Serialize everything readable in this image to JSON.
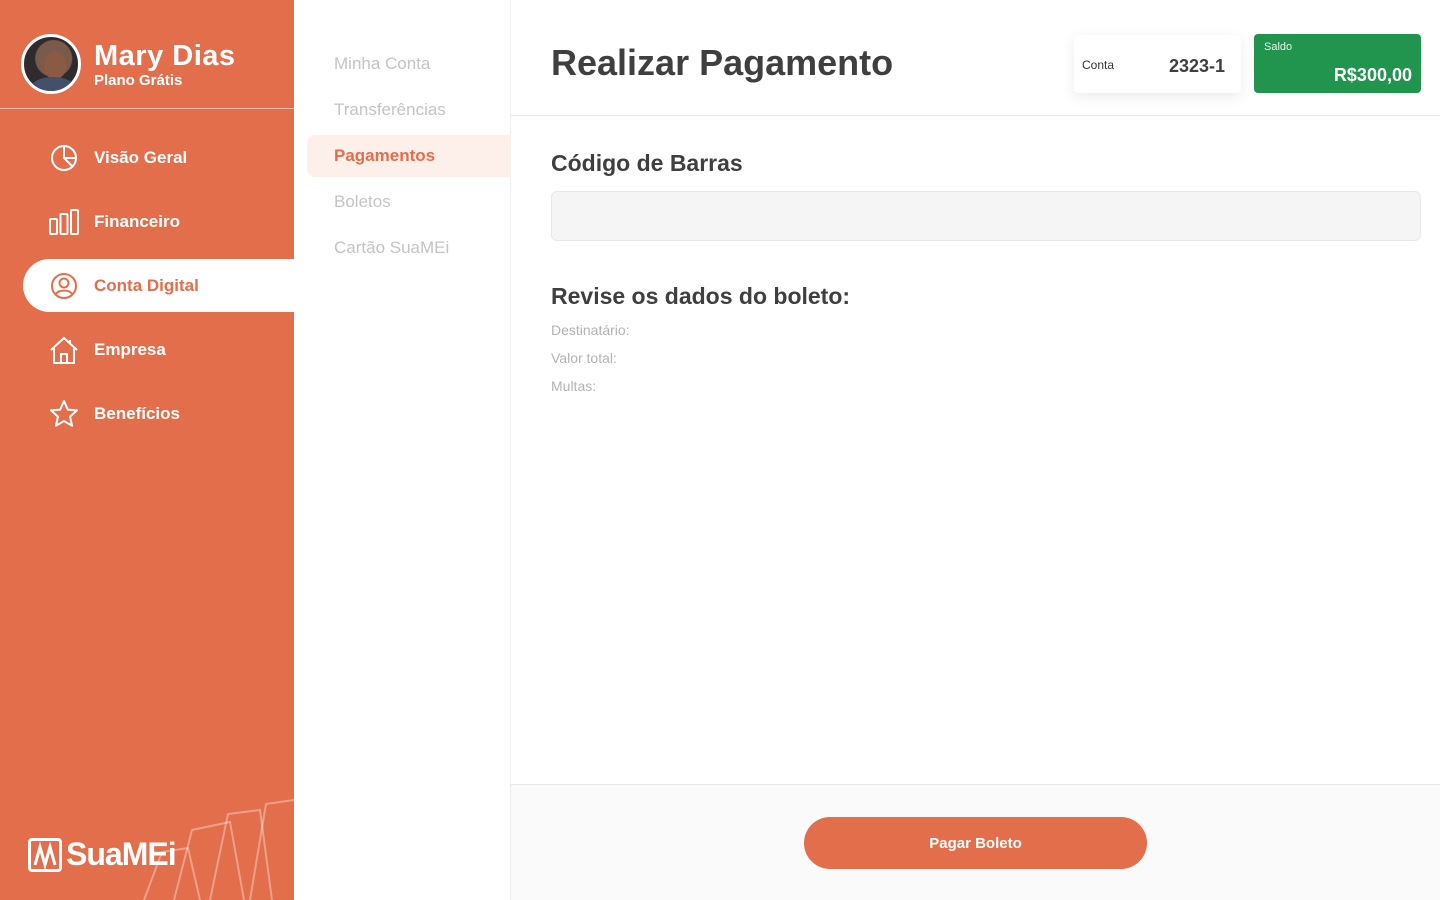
{
  "user": {
    "name": "Mary Dias",
    "plan": "Plano Grátis"
  },
  "sidebar": {
    "items": [
      {
        "label": "Visão Geral",
        "icon": "pie-chart-icon",
        "active": false
      },
      {
        "label": "Financeiro",
        "icon": "bar-chart-icon",
        "active": false
      },
      {
        "label": "Conta Digital",
        "icon": "user-circle-icon",
        "active": true
      },
      {
        "label": "Empresa",
        "icon": "home-icon",
        "active": false
      },
      {
        "label": "Benefícios",
        "icon": "star-icon",
        "active": false
      }
    ],
    "brand": "SuaMEi"
  },
  "subnav": {
    "items": [
      {
        "label": "Minha Conta",
        "active": false
      },
      {
        "label": "Transferências",
        "active": false
      },
      {
        "label": "Pagamentos",
        "active": true
      },
      {
        "label": "Boletos",
        "active": false
      },
      {
        "label": "Cartão SuaMEi",
        "active": false
      }
    ]
  },
  "header": {
    "title": "Realizar Pagamento",
    "account_label": "Conta",
    "account_number": "2323-1",
    "balance_label": "Saldo",
    "balance_value": "R$300,00"
  },
  "form": {
    "barcode_title": "Código de Barras",
    "barcode_value": "",
    "barcode_placeholder": "",
    "review_title": "Revise os dados do boleto:",
    "review_fields": [
      "Destinatário:",
      "Valor total:",
      "Multas:"
    ]
  },
  "footer": {
    "pay_button": "Pagar Boleto"
  },
  "colors": {
    "primary": "#e26e4b",
    "success": "#21944d",
    "text_dark": "#3f3f3f",
    "text_muted": "#c4c4c4"
  }
}
